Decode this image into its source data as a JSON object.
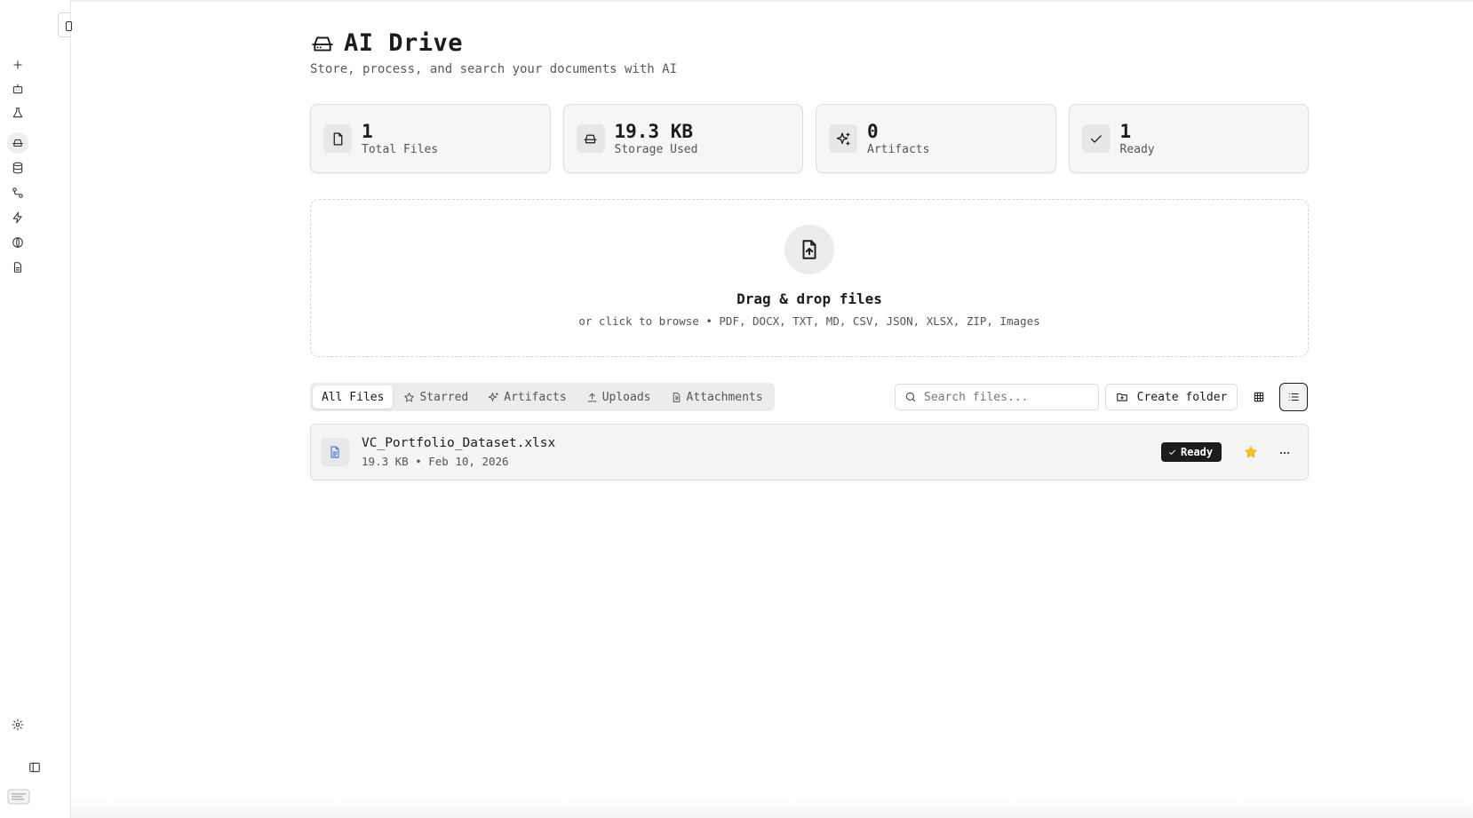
{
  "sidebar": {
    "items": [
      {
        "icon": "plus-icon"
      },
      {
        "icon": "bot-icon"
      },
      {
        "icon": "flask-icon"
      },
      {
        "icon": "hard-drive-icon",
        "active": true
      },
      {
        "icon": "database-icon"
      },
      {
        "icon": "workflow-icon"
      },
      {
        "icon": "zap-icon"
      },
      {
        "icon": "globe-icon"
      },
      {
        "icon": "file-text-icon"
      }
    ],
    "bottom": [
      {
        "icon": "settings-icon"
      },
      {
        "icon": "panel-left-icon"
      }
    ]
  },
  "header": {
    "title": "AI Drive",
    "subtitle": "Store, process, and search your documents with AI"
  },
  "stats": [
    {
      "value": "1",
      "label": "Total Files",
      "icon": "file-icon"
    },
    {
      "value": "19.3 KB",
      "label": "Storage Used",
      "icon": "hard-drive-icon"
    },
    {
      "value": "0",
      "label": "Artifacts",
      "icon": "sparkles-icon"
    },
    {
      "value": "1",
      "label": "Ready",
      "icon": "check-icon"
    }
  ],
  "dropzone": {
    "title": "Drag & drop files",
    "subtitle": "or click to browse • PDF, DOCX, TXT, MD, CSV, JSON, XLSX, ZIP, Images"
  },
  "tabs": [
    {
      "label": "All Files",
      "active": true
    },
    {
      "label": "Starred",
      "icon": "star-icon"
    },
    {
      "label": "Artifacts",
      "icon": "sparkles-icon"
    },
    {
      "label": "Uploads",
      "icon": "upload-icon"
    },
    {
      "label": "Attachments",
      "icon": "paperclip-file-icon"
    }
  ],
  "toolbar": {
    "search_placeholder": "Search files...",
    "create_folder_label": "Create folder",
    "view_mode": "list"
  },
  "files": [
    {
      "name": "VC_Portfolio_Dataset.xlsx",
      "meta": "19.3 KB • Feb 10, 2026",
      "status": "Ready",
      "starred": true
    }
  ],
  "colors": {
    "accent": "#1c1c1c",
    "star": "#f5c518",
    "file_icon": "#4a7be0"
  }
}
